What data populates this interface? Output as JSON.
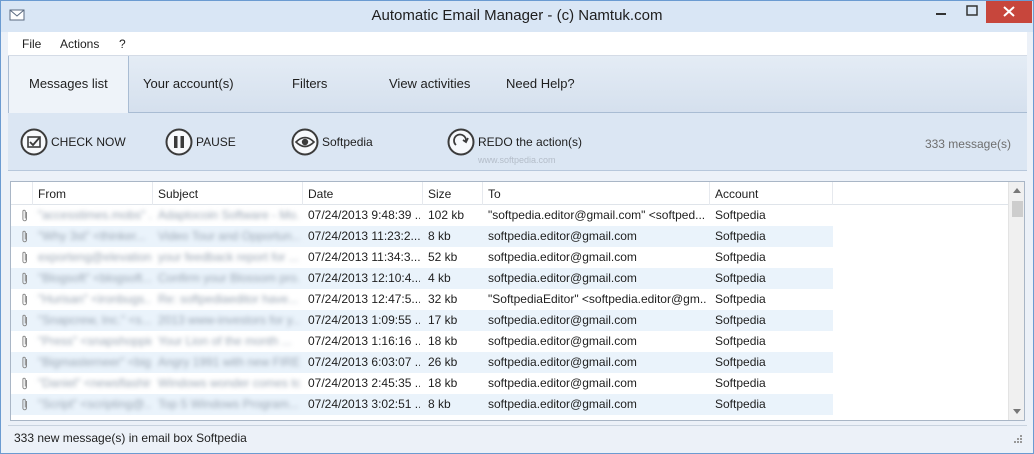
{
  "window": {
    "title": "Automatic Email Manager - (c) Namtuk.com",
    "minimize_icon": "minimize-icon",
    "maximize_icon": "maximize-icon",
    "close_icon": "close-icon"
  },
  "menu": [
    "File",
    "Actions",
    "?"
  ],
  "tabs": [
    "Messages list",
    "Your account(s)",
    "Filters",
    "View activities",
    "Need Help?"
  ],
  "active_tab": "Messages list",
  "toolbar": {
    "check_now": "CHECK NOW",
    "pause": "PAUSE",
    "account": "Softpedia",
    "redo": "REDO the action(s)",
    "message_count": "333 message(s)",
    "watermark": "www.softpedia.com"
  },
  "columns": [
    "From",
    "Subject",
    "Date",
    "Size",
    "To",
    "Account"
  ],
  "rows": [
    {
      "from": "\"accesstimes.mobs\" ...",
      "subject": "Adaptocoin Software - Mo...",
      "date": "07/24/2013 9:48:39 ...",
      "size": "102 kb",
      "to": "\"softpedia.editor@gmail.com\" <softped...",
      "account": "Softpedia"
    },
    {
      "from": "\"Why 3st\" <thinker...",
      "subject": "Video Tour and Opportun...",
      "date": "07/24/2013 11:23:2...",
      "size": "8 kb",
      "to": "softpedia.editor@gmail.com",
      "account": "Softpedia"
    },
    {
      "from": "exporteng@elevation...",
      "subject": "your feedback report for ...",
      "date": "07/24/2013 11:34:3...",
      "size": "52 kb",
      "to": "softpedia.editor@gmail.com",
      "account": "Softpedia"
    },
    {
      "from": "\"Blogsoft\" <blogsoft...",
      "subject": "Confirm your Blossom pro...",
      "date": "07/24/2013 12:10:4...",
      "size": "4 kb",
      "to": "softpedia.editor@gmail.com",
      "account": "Softpedia"
    },
    {
      "from": "\"Hurisan\" <ironbugs...",
      "subject": "Re: softpediaeditor have...",
      "date": "07/24/2013 12:47:5...",
      "size": "32 kb",
      "to": "\"SoftpediaEditor\" <softpedia.editor@gm...",
      "account": "Softpedia"
    },
    {
      "from": "\"Snapcrew, Inc.\" <s...",
      "subject": "2013 www-investors for y...",
      "date": "07/24/2013 1:09:55 ...",
      "size": "17 kb",
      "to": "softpedia.editor@gmail.com",
      "account": "Softpedia"
    },
    {
      "from": "\"Press\" <snapshopping...",
      "subject": "Your Lion of the month ...",
      "date": "07/24/2013 1:16:16 ...",
      "size": "18 kb",
      "to": "softpedia.editor@gmail.com",
      "account": "Softpedia"
    },
    {
      "from": "\"Bigmasterneer\" <big...",
      "subject": "Angry 1991 with new FIRE...",
      "date": "07/24/2013 6:03:07 ...",
      "size": "26 kb",
      "to": "softpedia.editor@gmail.com",
      "account": "Softpedia"
    },
    {
      "from": "\"Daniel\" <newsflashing...",
      "subject": "Windows wonder comes to ...",
      "date": "07/24/2013 2:45:35 ...",
      "size": "18 kb",
      "to": "softpedia.editor@gmail.com",
      "account": "Softpedia"
    },
    {
      "from": "\"Script\" <scripting@...",
      "subject": "Top 5 Windows Program...",
      "date": "07/24/2013 3:02:51 ...",
      "size": "8 kb",
      "to": "softpedia.editor@gmail.com",
      "account": "Softpedia"
    }
  ],
  "status": "333 new message(s) in email box Softpedia",
  "colors": {
    "alt_row": "#eaf3fb",
    "toolbar_bg": "#dbe6f3",
    "close_button": "#c7463c"
  }
}
